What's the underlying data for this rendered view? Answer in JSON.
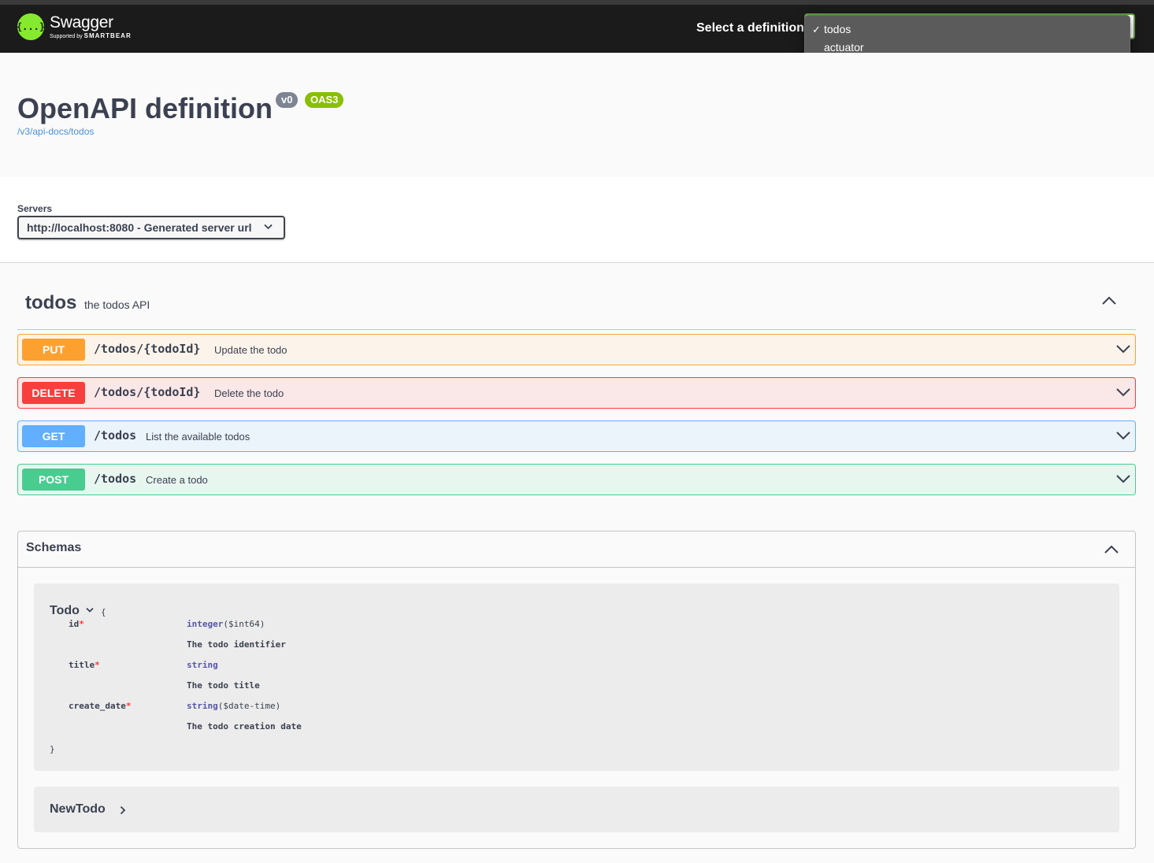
{
  "topbar": {
    "logo_icon": "{...}",
    "logo_name": "Swagger",
    "logo_sub_prefix": "Supported by",
    "logo_sub_brand": "SMARTBEAR",
    "definition_label": "Select a definition",
    "definition_options": [
      {
        "label": "todos",
        "selected": true,
        "check": "✓"
      },
      {
        "label": "actuator",
        "selected": false
      }
    ]
  },
  "info": {
    "title": "OpenAPI definition",
    "version_badge": "v0",
    "oas_badge": "OAS3",
    "url": "/v3/api-docs/todos"
  },
  "servers": {
    "label": "Servers",
    "selected": "http://localhost:8080 - Generated server url"
  },
  "tag": {
    "name": "todos",
    "description": "the todos API"
  },
  "operations": [
    {
      "method": "PUT",
      "path": "/todos/{todoId}",
      "summary": "Update the todo",
      "color": "#fca130"
    },
    {
      "method": "DELETE",
      "path": "/todos/{todoId}",
      "summary": "Delete the todo",
      "color": "#f93e3e"
    },
    {
      "method": "GET",
      "path": "/todos",
      "summary": "List the available todos",
      "color": "#61affe"
    },
    {
      "method": "POST",
      "path": "/todos",
      "summary": "Create a todo",
      "color": "#49cc90"
    }
  ],
  "schemas": {
    "title": "Schemas",
    "models": [
      {
        "name": "Todo",
        "open_brace": "{",
        "close_brace": "}",
        "properties": [
          {
            "name": "id",
            "required": "*",
            "type": "integer",
            "format": "($int64)",
            "description": "The todo identifier"
          },
          {
            "name": "title",
            "required": "*",
            "type": "string",
            "format": "",
            "description": "The todo title"
          },
          {
            "name": "create_date",
            "required": "*",
            "type": "string",
            "format": "($date-time)",
            "description": "The todo creation date"
          }
        ]
      },
      {
        "name": "NewTodo"
      }
    ]
  }
}
